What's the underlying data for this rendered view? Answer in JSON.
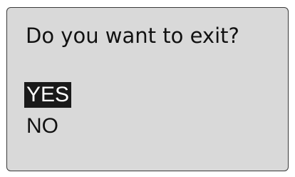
{
  "dialog": {
    "prompt": "Do you want to exit?",
    "options": [
      {
        "label": "YES",
        "selected": true
      },
      {
        "label": "NO",
        "selected": false
      }
    ]
  },
  "colors": {
    "panel": "#d9d9d9",
    "border": "#3a3a3a",
    "text": "#111111",
    "highlight_bg": "#1a1a1a",
    "highlight_text": "#ffffff"
  }
}
